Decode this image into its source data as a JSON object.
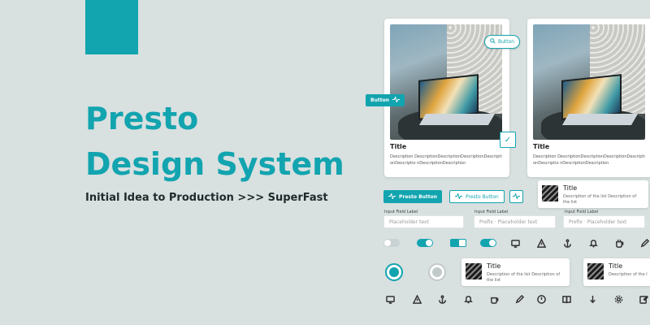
{
  "hero": {
    "title_line1": "Presto",
    "title_line2": "Design System",
    "subtitle": "Initial Idea to Production >>> SuperFast"
  },
  "colors": {
    "accent": "#12a4af",
    "background": "#d8e0e0"
  },
  "cards": [
    {
      "title": "Title",
      "description": "Description DescriptionDescriptionDescriptionDescriptionDescriptio nDescriptionDescription"
    },
    {
      "title": "Title",
      "description": "Description DescriptionDescriptionDescriptionDescriptionDescriptio nDescriptionDescription"
    }
  ],
  "buttons": {
    "search_pill": "Button",
    "teal_small": "Button",
    "presto_primary": "Presto Button",
    "presto_outline": "Presto Button"
  },
  "list_items": [
    {
      "title": "Title",
      "description": "Description of the list Description of the list"
    },
    {
      "title": "Title",
      "description": "Description of the list Description of the list"
    },
    {
      "title": "Title",
      "description": "Description of the list Description of the list"
    }
  ],
  "fields": [
    {
      "label": "Input Field Label",
      "placeholder": "Placeholder text"
    },
    {
      "label": "Input Field Label",
      "placeholder": "Prefix · Placeholder text"
    },
    {
      "label": "Input Field Label",
      "placeholder": "Prefix · Placeholder text"
    }
  ],
  "icons_row1": [
    "monitor-icon",
    "warning-icon",
    "anchor-icon",
    "bell-icon",
    "cup-icon",
    "pen-icon"
  ],
  "icons_row2": [
    "monitor-icon",
    "warning-icon",
    "anchor-icon",
    "bell-icon",
    "cup-icon",
    "pen-icon",
    "clock-icon",
    "book-icon",
    "arrow-down-icon",
    "settings-icon",
    "edit-icon"
  ]
}
